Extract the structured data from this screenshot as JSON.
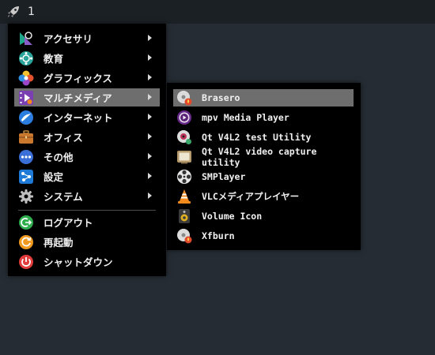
{
  "taskbar": {
    "workspace": "1",
    "launcher_icon": "rocket-icon"
  },
  "main_menu": {
    "items": [
      {
        "label": "アクセサリ",
        "icon": "accessories-icon",
        "submenu": true
      },
      {
        "label": "教育",
        "icon": "education-icon",
        "submenu": true
      },
      {
        "label": "グラフィックス",
        "icon": "graphics-icon",
        "submenu": true
      },
      {
        "label": "マルチメディア",
        "icon": "multimedia-icon",
        "submenu": true,
        "active": true
      },
      {
        "label": "インターネット",
        "icon": "internet-icon",
        "submenu": true
      },
      {
        "label": "オフィス",
        "icon": "office-icon",
        "submenu": true
      },
      {
        "label": "その他",
        "icon": "other-icon",
        "submenu": true
      },
      {
        "label": "設定",
        "icon": "settings-icon",
        "submenu": true
      },
      {
        "label": "システム",
        "icon": "system-icon",
        "submenu": true
      }
    ],
    "session": [
      {
        "label": "ログアウト",
        "icon": "logout-icon"
      },
      {
        "label": "再起動",
        "icon": "reboot-icon"
      },
      {
        "label": "シャットダウン",
        "icon": "shutdown-icon"
      }
    ]
  },
  "submenu": {
    "items": [
      {
        "label": "Brasero",
        "icon": "brasero-icon",
        "active": true
      },
      {
        "label": "mpv Media Player",
        "icon": "mpv-icon"
      },
      {
        "label": "Qt V4L2 test Utility",
        "icon": "qv4l2-icon"
      },
      {
        "label": "Qt V4L2 video capture utility",
        "icon": "qvidcap-icon"
      },
      {
        "label": "SMPlayer",
        "icon": "smplayer-icon"
      },
      {
        "label": "VLCメディアプレイヤー",
        "icon": "vlc-icon"
      },
      {
        "label": "Volume Icon",
        "icon": "volume-icon"
      },
      {
        "label": "Xfburn",
        "icon": "xfburn-icon"
      }
    ]
  },
  "colors": {
    "background": "#252c33",
    "menu": "#000000",
    "highlight": "#6e6e6e",
    "topbar": "#1b2025"
  }
}
